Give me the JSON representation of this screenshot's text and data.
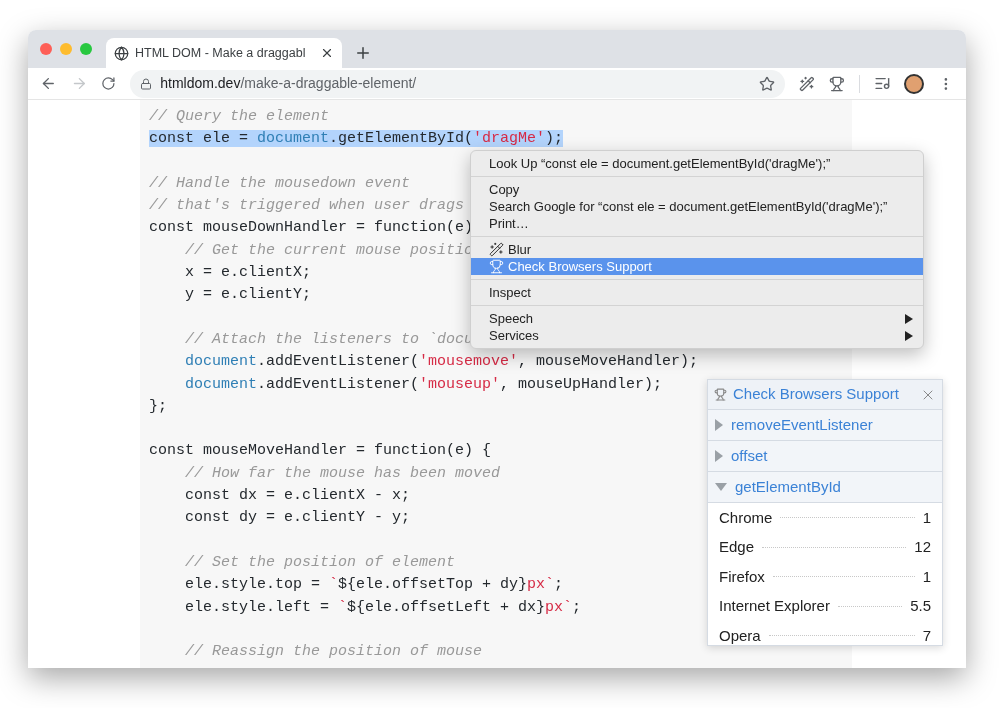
{
  "browser": {
    "tab": {
      "title": "HTML DOM - Make a draggabl",
      "selected": true
    },
    "url": {
      "domain": "htmldom.dev",
      "path": "/make-a-draggable-element/"
    }
  },
  "code": [
    {
      "kind": "code",
      "selected": false,
      "segments": [
        {
          "text": "// Query the element",
          "kind": "comment"
        }
      ]
    },
    {
      "kind": "code",
      "selected": true,
      "segments": [
        {
          "text": "const ele = ",
          "kind": "plain"
        },
        {
          "text": "document",
          "kind": "builtin"
        },
        {
          "text": ".getElementById(",
          "kind": "plain"
        },
        {
          "text": "'dragMe'",
          "kind": "string"
        },
        {
          "text": ");",
          "kind": "plain"
        }
      ]
    },
    {
      "kind": "blank"
    },
    {
      "kind": "code",
      "selected": false,
      "segments": [
        {
          "text": "// Handle the mousedown event",
          "kind": "comment"
        }
      ]
    },
    {
      "kind": "code",
      "selected": false,
      "segments": [
        {
          "text": "// that's triggered when user drags",
          "kind": "comment"
        }
      ]
    },
    {
      "kind": "code",
      "selected": false,
      "segments": [
        {
          "text": "const mouseDownHandler = function(e)",
          "kind": "plain"
        }
      ]
    },
    {
      "kind": "code",
      "selected": false,
      "segments": [
        {
          "text": "    // Get the current mouse positio",
          "kind": "comment"
        }
      ]
    },
    {
      "kind": "code",
      "selected": false,
      "segments": [
        {
          "text": "    x = e.clientX;",
          "kind": "plain"
        }
      ]
    },
    {
      "kind": "code",
      "selected": false,
      "segments": [
        {
          "text": "    y = e.clientY;",
          "kind": "plain"
        }
      ]
    },
    {
      "kind": "blank"
    },
    {
      "kind": "code",
      "selected": false,
      "segments": [
        {
          "text": "    // Attach the listeners to `docu",
          "kind": "comment"
        }
      ]
    },
    {
      "kind": "code",
      "selected": false,
      "segments": [
        {
          "text": "    document",
          "kind": "builtin"
        },
        {
          "text": ".addEventListener(",
          "kind": "plain"
        },
        {
          "text": "'mousemove'",
          "kind": "string"
        },
        {
          "text": ", mouseMoveHandler);",
          "kind": "plain"
        }
      ]
    },
    {
      "kind": "code",
      "selected": false,
      "segments": [
        {
          "text": "    document",
          "kind": "builtin"
        },
        {
          "text": ".addEventListener(",
          "kind": "plain"
        },
        {
          "text": "'mouseup'",
          "kind": "string"
        },
        {
          "text": ", mouseUpHandler);",
          "kind": "plain"
        }
      ]
    },
    {
      "kind": "code",
      "selected": false,
      "segments": [
        {
          "text": "};",
          "kind": "plain"
        }
      ]
    },
    {
      "kind": "blank"
    },
    {
      "kind": "code",
      "selected": false,
      "segments": [
        {
          "text": "const mouseMoveHandler = function(e) {",
          "kind": "plain"
        }
      ]
    },
    {
      "kind": "code",
      "selected": false,
      "segments": [
        {
          "text": "    // How far the mouse has been moved",
          "kind": "comment"
        }
      ]
    },
    {
      "kind": "code",
      "selected": false,
      "segments": [
        {
          "text": "    const dx = e.clientX - x;",
          "kind": "plain"
        }
      ]
    },
    {
      "kind": "code",
      "selected": false,
      "segments": [
        {
          "text": "    const dy = e.clientY - y;",
          "kind": "plain"
        }
      ]
    },
    {
      "kind": "blank"
    },
    {
      "kind": "code",
      "selected": false,
      "segments": [
        {
          "text": "    // Set the position of element",
          "kind": "comment"
        }
      ]
    },
    {
      "kind": "code",
      "selected": false,
      "segments": [
        {
          "text": "    ele.style.top = ",
          "kind": "plain"
        },
        {
          "text": "`",
          "kind": "string"
        },
        {
          "text": "${ele.offsetTop + dy}",
          "kind": "plain"
        },
        {
          "text": "px`",
          "kind": "string"
        },
        {
          "text": ";",
          "kind": "plain"
        }
      ]
    },
    {
      "kind": "code",
      "selected": false,
      "segments": [
        {
          "text": "    ele.style.left = ",
          "kind": "plain"
        },
        {
          "text": "`",
          "kind": "string"
        },
        {
          "text": "${ele.offsetLeft + dx}",
          "kind": "plain"
        },
        {
          "text": "px`",
          "kind": "string"
        },
        {
          "text": ";",
          "kind": "plain"
        }
      ]
    },
    {
      "kind": "blank"
    },
    {
      "kind": "code",
      "selected": false,
      "segments": [
        {
          "text": "    // Reassign the position of mouse",
          "kind": "comment"
        }
      ]
    }
  ],
  "context_menu": [
    [
      {
        "label": "Look Up “const ele = document.getElementById('dragMe');”",
        "selected": false,
        "submenu": false
      }
    ],
    [
      {
        "label": "Copy",
        "selected": false,
        "submenu": false
      },
      {
        "label": "Search Google for “const ele = document.getElementById('dragMe');”",
        "selected": false,
        "submenu": false
      },
      {
        "label": "Print…",
        "selected": false,
        "submenu": false
      }
    ],
    [
      {
        "label": "Blur",
        "selected": false,
        "submenu": false,
        "kind": "wand"
      },
      {
        "label": "Check Browsers Support",
        "selected": true,
        "submenu": false,
        "kind": "trophy"
      }
    ],
    [
      {
        "label": "Inspect",
        "selected": false,
        "submenu": false
      }
    ],
    [
      {
        "label": "Speech",
        "selected": false,
        "submenu": true
      },
      {
        "label": "Services",
        "selected": false,
        "submenu": true
      }
    ]
  ],
  "support_panel": {
    "title": "Check Browsers Support",
    "sections": [
      {
        "name": "removeEventListener",
        "expanded": false
      },
      {
        "name": "offset",
        "expanded": false
      },
      {
        "name": "getElementById",
        "expanded": true,
        "rows": [
          {
            "browser": "Chrome",
            "version": "1"
          },
          {
            "browser": "Edge",
            "version": "12"
          },
          {
            "browser": "Firefox",
            "version": "1"
          },
          {
            "browser": "Internet Explorer",
            "version": "5.5"
          },
          {
            "browser": "Opera",
            "version": "7"
          }
        ]
      }
    ]
  }
}
